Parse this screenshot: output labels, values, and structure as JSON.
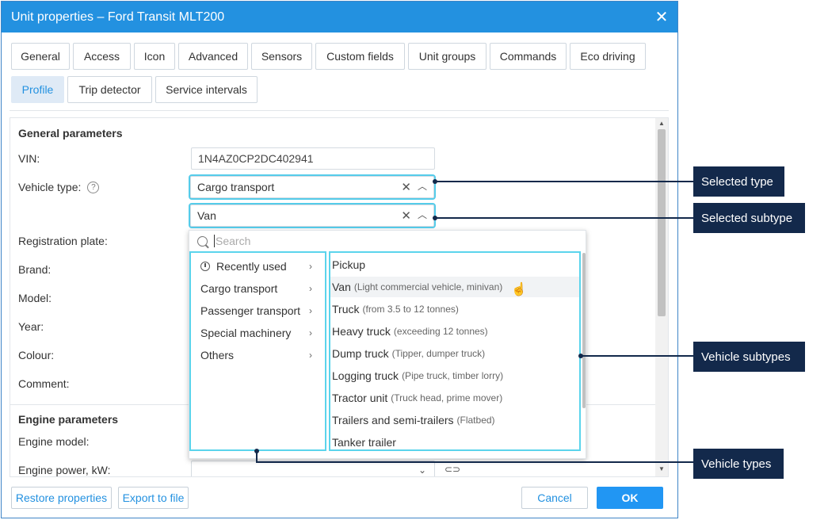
{
  "window": {
    "title": "Unit properties – Ford Transit MLT200",
    "close": "✕"
  },
  "tabs": [
    {
      "label": "General"
    },
    {
      "label": "Access"
    },
    {
      "label": "Icon"
    },
    {
      "label": "Advanced"
    },
    {
      "label": "Sensors"
    },
    {
      "label": "Custom fields"
    },
    {
      "label": "Unit groups"
    },
    {
      "label": "Commands"
    },
    {
      "label": "Eco driving"
    },
    {
      "label": "Profile",
      "active": true
    },
    {
      "label": "Trip detector"
    },
    {
      "label": "Service intervals"
    }
  ],
  "general": {
    "title": "General parameters",
    "vin_label": "VIN:",
    "vin_value": "1N4AZ0CP2DC402941",
    "vehicle_type_label": "Vehicle type:",
    "vehicle_type_value": "Cargo transport",
    "vehicle_subtype_value": "Van",
    "registration_label": "Registration plate:",
    "brand_label": "Brand:",
    "model_label": "Model:",
    "year_label": "Year:",
    "colour_label": "Colour:",
    "comment_label": "Comment:"
  },
  "engine": {
    "title": "Engine parameters",
    "model_label": "Engine model:",
    "power_label": "Engine power, kW:"
  },
  "dropdown": {
    "search_placeholder": "Search",
    "types": [
      {
        "label": "Recently used",
        "icon": "clock-icon"
      },
      {
        "label": "Cargo transport"
      },
      {
        "label": "Passenger transport"
      },
      {
        "label": "Special machinery"
      },
      {
        "label": "Others"
      }
    ],
    "subtypes": [
      {
        "label": "Pickup",
        "note": ""
      },
      {
        "label": "Van",
        "note": "(Light commercial vehicle, minivan)"
      },
      {
        "label": "Truck",
        "note": "(from 3.5 to 12 tonnes)"
      },
      {
        "label": "Heavy truck",
        "note": "(exceeding 12 tonnes)"
      },
      {
        "label": "Dump truck",
        "note": "(Tipper, dumper truck)"
      },
      {
        "label": "Logging truck",
        "note": "(Pipe truck, timber lorry)"
      },
      {
        "label": "Tractor unit",
        "note": "(Truck head, prime mover)"
      },
      {
        "label": "Trailers and semi-trailers",
        "note": "(Flatbed)"
      },
      {
        "label": "Tanker trailer",
        "note": ""
      }
    ]
  },
  "footer": {
    "restore": "Restore properties",
    "export": "Export to file",
    "cancel": "Cancel",
    "ok": "OK"
  },
  "callouts": {
    "selected_type": "Selected type",
    "selected_subtype": "Selected subtype",
    "vehicle_subtypes": "Vehicle subtypes",
    "vehicle_types": "Vehicle types"
  }
}
